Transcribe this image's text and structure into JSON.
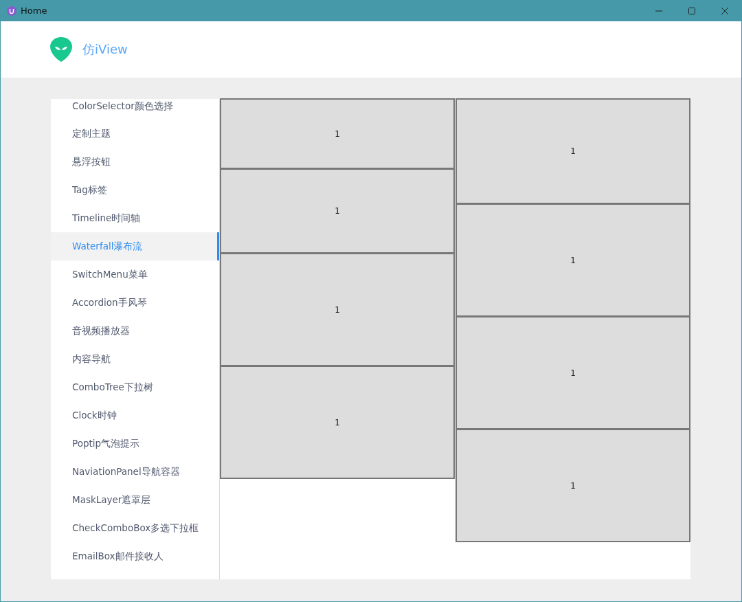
{
  "window": {
    "title": "Home"
  },
  "header": {
    "title": "仿iView"
  },
  "sidebar": {
    "items": [
      {
        "label": "ColorSelector颜色选择",
        "selected": false
      },
      {
        "label": "定制主题",
        "selected": false
      },
      {
        "label": "悬浮按钮",
        "selected": false
      },
      {
        "label": "Tag标签",
        "selected": false
      },
      {
        "label": "Timeline时间轴",
        "selected": false
      },
      {
        "label": "Waterfall瀑布流",
        "selected": true
      },
      {
        "label": "SwitchMenu菜单",
        "selected": false
      },
      {
        "label": "Accordion手风琴",
        "selected": false
      },
      {
        "label": "音视频播放器",
        "selected": false
      },
      {
        "label": "内容导航",
        "selected": false
      },
      {
        "label": "ComboTree下拉树",
        "selected": false
      },
      {
        "label": "Clock时钟",
        "selected": false
      },
      {
        "label": "Poptip气泡提示",
        "selected": false
      },
      {
        "label": "NaviationPanel导航容器",
        "selected": false
      },
      {
        "label": "MaskLayer遮罩层",
        "selected": false
      },
      {
        "label": "CheckComboBox多选下拉框",
        "selected": false
      },
      {
        "label": "EmailBox邮件接收人",
        "selected": false
      }
    ]
  },
  "waterfall": {
    "columns": [
      {
        "items": [
          {
            "label": "1",
            "kind": "short"
          },
          {
            "label": "1",
            "kind": "medium"
          },
          {
            "label": "1",
            "kind": "tall"
          },
          {
            "label": "1",
            "kind": "tall"
          }
        ]
      },
      {
        "items": [
          {
            "label": "1",
            "kind": "medium"
          },
          {
            "label": "1",
            "kind": "tall"
          },
          {
            "label": "1",
            "kind": "tall"
          },
          {
            "label": "1",
            "kind": "tall"
          }
        ]
      }
    ]
  }
}
